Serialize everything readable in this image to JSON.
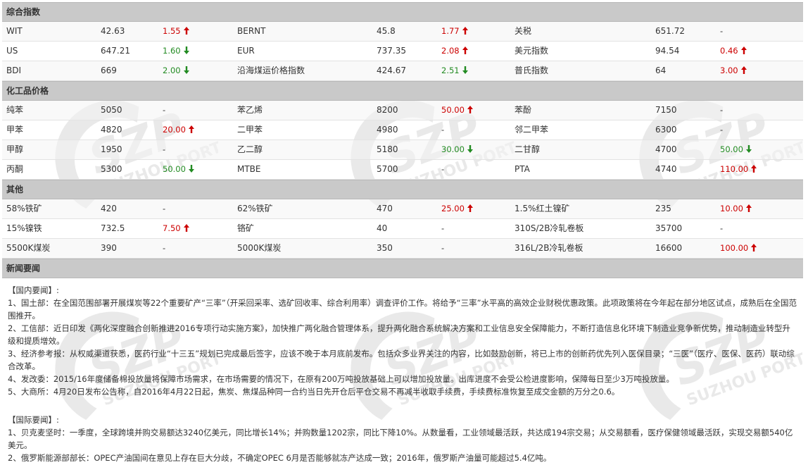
{
  "colors": {
    "up": "#cc0000",
    "down": "#228b22",
    "header_bg": "#c9c9c9"
  },
  "sections": {
    "composite": {
      "title": "综合指数",
      "rows": [
        [
          {
            "n": "WIT",
            "v": "42.63",
            "c": "1.55",
            "d": "up"
          },
          {
            "n": "BERNT",
            "v": "45.8",
            "c": "1.77",
            "d": "up"
          },
          {
            "n": "关税",
            "v": "651.72",
            "c": "-",
            "d": "none"
          }
        ],
        [
          {
            "n": "US",
            "v": "647.21",
            "c": "1.60",
            "d": "down"
          },
          {
            "n": "EUR",
            "v": "737.35",
            "c": "2.08",
            "d": "up"
          },
          {
            "n": "美元指数",
            "v": "94.54",
            "c": "0.46",
            "d": "up"
          }
        ],
        [
          {
            "n": "BDI",
            "v": "669",
            "c": "2.00",
            "d": "down"
          },
          {
            "n": "沿海煤运价格指数",
            "v": "424.67",
            "c": "2.51",
            "d": "down"
          },
          {
            "n": "普氏指数",
            "v": "64",
            "c": "3.00",
            "d": "up"
          }
        ]
      ]
    },
    "chemical": {
      "title": "化工品价格",
      "rows": [
        [
          {
            "n": "纯苯",
            "v": "5050",
            "c": "-",
            "d": "none"
          },
          {
            "n": "苯乙烯",
            "v": "8200",
            "c": "50.00",
            "d": "up"
          },
          {
            "n": "苯酚",
            "v": "7150",
            "c": "-",
            "d": "none"
          }
        ],
        [
          {
            "n": "甲苯",
            "v": "4820",
            "c": "20.00",
            "d": "up"
          },
          {
            "n": "二甲苯",
            "v": "4980",
            "c": "-",
            "d": "none"
          },
          {
            "n": "邻二甲苯",
            "v": "6300",
            "c": "-",
            "d": "none"
          }
        ],
        [
          {
            "n": "甲醇",
            "v": "1950",
            "c": "-",
            "d": "none"
          },
          {
            "n": "乙二醇",
            "v": "5180",
            "c": "30.00",
            "d": "down"
          },
          {
            "n": "二甘醇",
            "v": "4700",
            "c": "50.00",
            "d": "down"
          }
        ],
        [
          {
            "n": "丙酮",
            "v": "5300",
            "c": "50.00",
            "d": "down"
          },
          {
            "n": "MTBE",
            "v": "5700",
            "c": "-",
            "d": "none"
          },
          {
            "n": "PTA",
            "v": "4740",
            "c": "110.00",
            "d": "up"
          }
        ]
      ]
    },
    "other": {
      "title": "其他",
      "rows": [
        [
          {
            "n": "58%铁矿",
            "v": "420",
            "c": "-",
            "d": "none"
          },
          {
            "n": "62%铁矿",
            "v": "470",
            "c": "25.00",
            "d": "up"
          },
          {
            "n": "1.5%红土镍矿",
            "v": "235",
            "c": "10.00",
            "d": "up"
          }
        ],
        [
          {
            "n": "15%镍铁",
            "v": "732.5",
            "c": "7.50",
            "d": "up"
          },
          {
            "n": "铬矿",
            "v": "40",
            "c": "-",
            "d": "none"
          },
          {
            "n": "310S/2B冷轧卷板",
            "v": "35700",
            "c": "-",
            "d": "none"
          }
        ],
        [
          {
            "n": "5500K煤炭",
            "v": "390",
            "c": "-",
            "d": "none"
          },
          {
            "n": "5000K煤炭",
            "v": "350",
            "c": "-",
            "d": "none"
          },
          {
            "n": "316L/2B冷轧卷板",
            "v": "16600",
            "c": "100.00",
            "d": "up"
          }
        ]
      ]
    },
    "news": {
      "title": "新闻要闻",
      "domestic_heading": "【国内要闻】:",
      "domestic": [
        "1、国土部：在全国范围部署开展煤炭等22个重要矿产“三率”（开采回采率、选矿回收率、综合利用率）调查评价工作。将给予“三率”水平高的高效企业财税优惠政策。此项政策将在今年起在部分地区试点，成熟后在全国范围推开。",
        "2、工信部：近日印发《两化深度融合创新推进2016专项行动实施方案》，加快推广两化融合管理体系，提升两化融合系统解决方案和工业信息安全保障能力，不断打造信息化环境下制造业竞争新优势，推动制造业转型升级和提质增效。",
        "3、经济参考报：从权威渠道获悉，医药行业“十三五”规划已完成最后签字，应该不晚于本月底前发布。包括众多业界关注的内容，比如鼓励创新，将已上市的创新药优先列入医保目录；“三医”（医疗、医保、医药）联动综合改革。",
        "4、发改委：2015/16年度储备棉投放量将保障市场需求，在市场需要的情况下，在原有200万吨投放基础上可以增加投放量。出库进度不会受公检进度影响，保障每日至少3万吨投放量。",
        "5、大商所：4月20日发布公告称，自2016年4月22日起，焦炭、焦煤品种同一合约当日先开仓后平仓交易不再减半收取手续费，手续费标准恢复至成交金额的万分之0.6。"
      ],
      "intl_heading": "【国际要闻】:",
      "intl": [
        "1、贝克麦坚时：一季度，全球跨境并购交易额达3240亿美元，同比增长14%；并购数量1202宗，同比下降10%。从数量看，工业领域最活跃，共达成194宗交易；从交易额看，医疗保健领域最活跃，实现交易额540亿美元。",
        "2、俄罗斯能源部部长：OPEC产油国间在意见上存在巨大分歧，不确定OPEC 6月是否能够就冻产达成一致；2016年，俄罗斯产油量可能超过5.4亿吨。"
      ]
    }
  },
  "watermark": {
    "text": "SUZHOU PORT"
  }
}
